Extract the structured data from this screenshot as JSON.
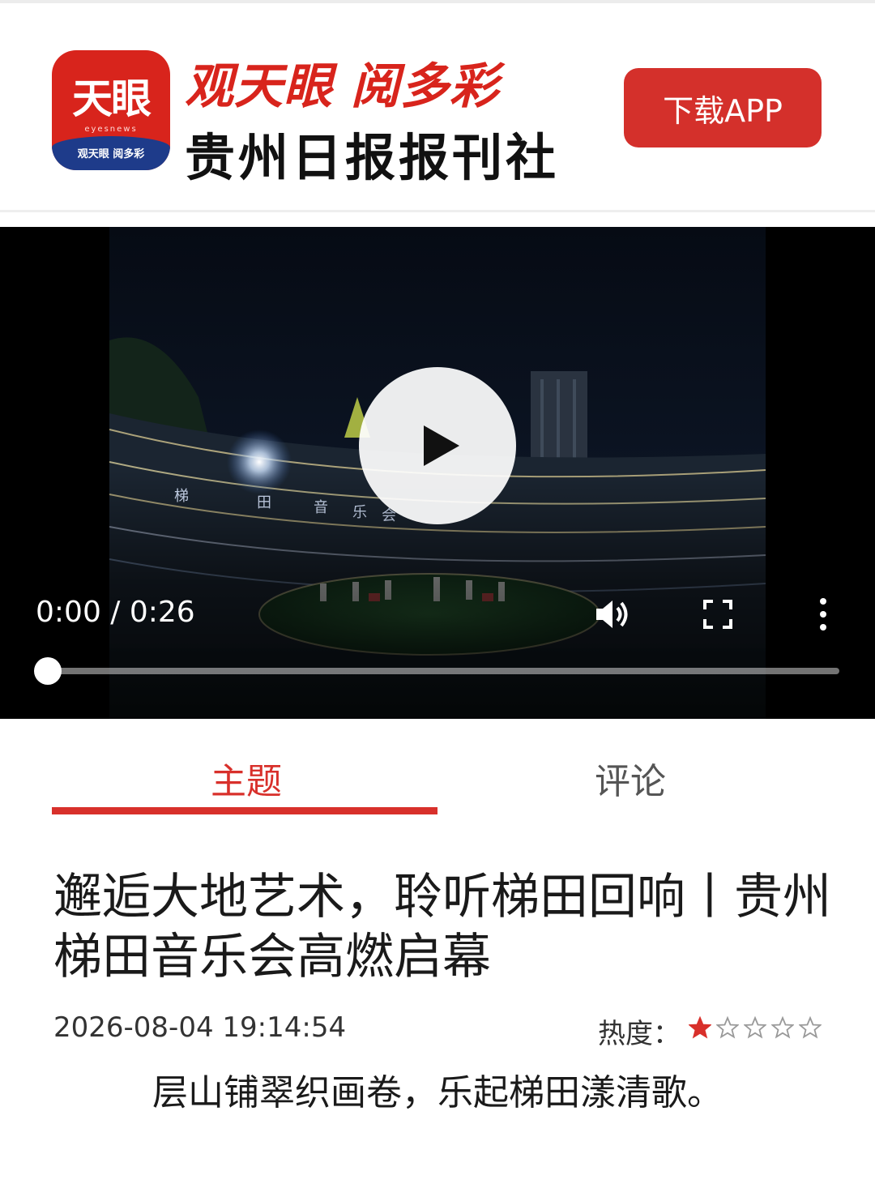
{
  "header": {
    "logo_text": "天眼",
    "logo_subtext": "eyesnews",
    "logo_band_text": "观天眼 阅多彩",
    "slogan": "观天眼  阅多彩",
    "org_name": "贵州日报报刊社",
    "download_label": "下载APP",
    "brand_color": "#d8241c"
  },
  "video": {
    "current_time": "0:00",
    "duration": "0:26",
    "time_display": "0:00 / 0:26",
    "progress": 0,
    "scene_banner_chars": [
      "梯",
      "田",
      "音",
      "乐",
      "会"
    ],
    "icons": [
      "play-icon",
      "volume-icon",
      "fullscreen-icon",
      "more-vertical-icon"
    ]
  },
  "tabs": [
    {
      "label": "主题",
      "active": true
    },
    {
      "label": "评论",
      "active": false
    }
  ],
  "article": {
    "title": "邂逅大地艺术，聆听梯田回响丨贵州梯田音乐会高燃启幕",
    "date": "2026-08-04 19:14:54",
    "heat_label": "热度：",
    "heat_rating": 1,
    "heat_max": 5,
    "intro": "层山铺翠织画卷，乐起梯田漾清歌。",
    "accent_color": "#d8302b"
  }
}
